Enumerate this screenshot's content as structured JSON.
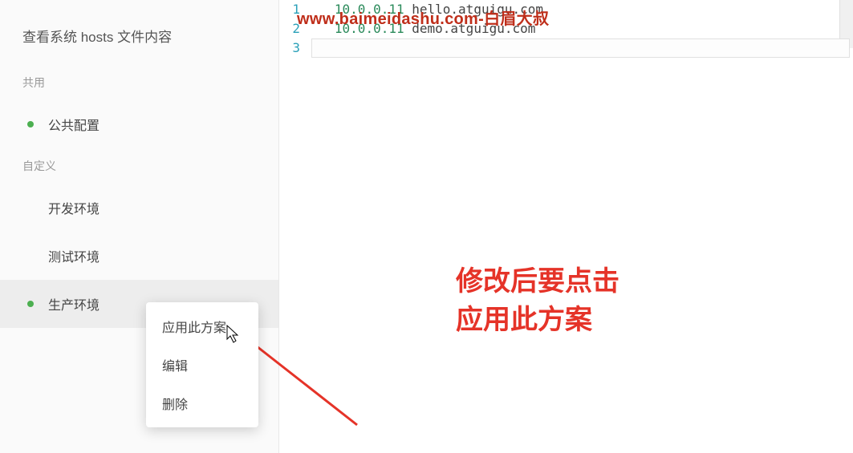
{
  "sidebar": {
    "title": "查看系统 hosts 文件内容",
    "section_shared": "共用",
    "section_custom": "自定义",
    "item_public": "公共配置",
    "item_dev": "开发环境",
    "item_test": "测试环境",
    "item_prod": "生产环境"
  },
  "context_menu": {
    "apply": "应用此方案",
    "edit": "编辑",
    "delete": "删除"
  },
  "editor": {
    "lines": [
      {
        "num": "1",
        "ip": "10.0.0.11",
        "host": "hello.atguigu.com"
      },
      {
        "num": "2",
        "ip": "10.0.0.11",
        "host": "demo.atguigu.com"
      },
      {
        "num": "3",
        "ip": "",
        "host": ""
      }
    ]
  },
  "watermark": "www.baimeidashu.com-白眉大叔",
  "annotation": {
    "line1": "修改后要点击",
    "line2": "应用此方案"
  }
}
